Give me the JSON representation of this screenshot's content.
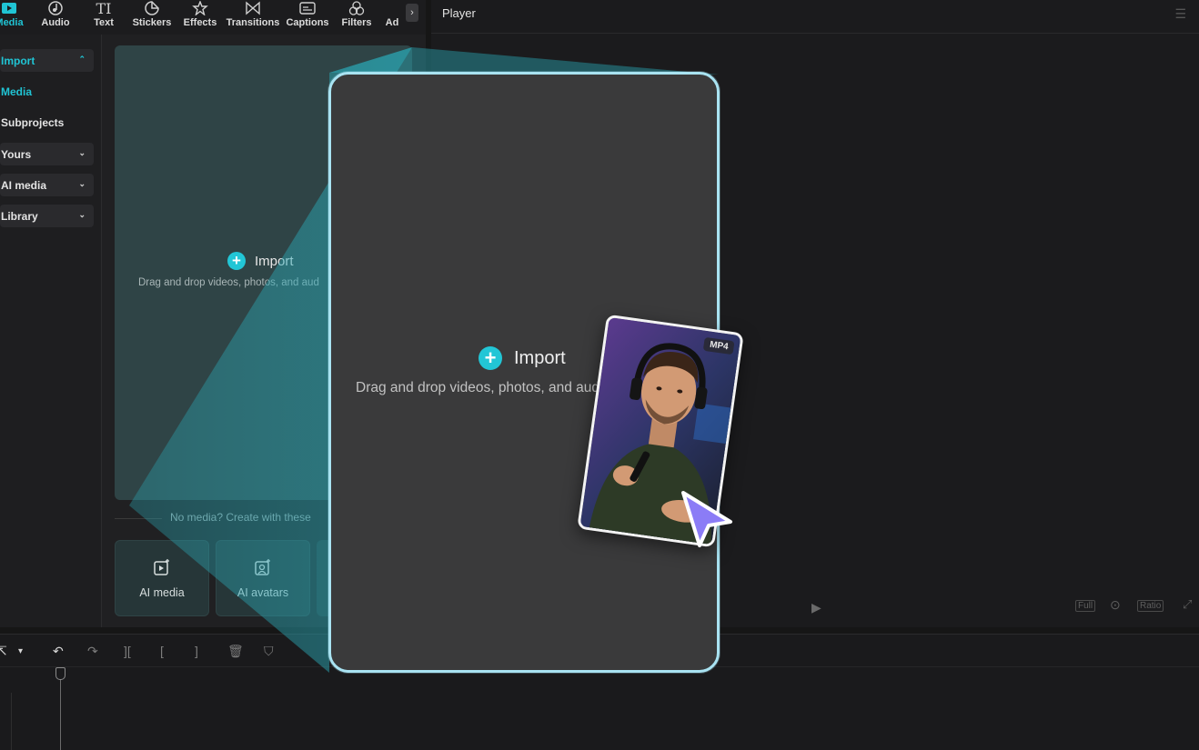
{
  "toolbar": {
    "tools": [
      {
        "label": "Media",
        "icon": "media-icon",
        "active": true
      },
      {
        "label": "Audio",
        "icon": "audio-icon"
      },
      {
        "label": "Text",
        "icon": "text-icon"
      },
      {
        "label": "Stickers",
        "icon": "stickers-icon"
      },
      {
        "label": "Effects",
        "icon": "effects-icon"
      },
      {
        "label": "Transitions",
        "icon": "transitions-icon"
      },
      {
        "label": "Captions",
        "icon": "captions-icon"
      },
      {
        "label": "Filters",
        "icon": "filters-icon"
      },
      {
        "label": "Ad",
        "icon": "adjust-icon"
      }
    ],
    "more_icon": "chevron-right-icon"
  },
  "sidenav": {
    "items": [
      {
        "label": "Import",
        "expanded": true
      },
      {
        "label": "Media"
      },
      {
        "label": "Subprojects"
      },
      {
        "label": "Yours"
      },
      {
        "label": "AI media"
      },
      {
        "label": "Library"
      }
    ]
  },
  "media_panel": {
    "import_label": "Import",
    "drag_hint": "Drag and drop videos, photos, and aud",
    "no_media_text": "No media? Create with these",
    "ai_cards": [
      {
        "label": "AI media",
        "icon": "ai-media-icon"
      },
      {
        "label": "AI avatars",
        "icon": "ai-avatars-icon"
      }
    ]
  },
  "player": {
    "title": "Player",
    "controls": [
      "Full",
      "Ratio"
    ]
  },
  "modal": {
    "import_label": "Import",
    "drag_hint": "Drag and drop videos, photos, and aud"
  },
  "thumbnail": {
    "badge": "MP4"
  },
  "colors": {
    "accent": "#22c6d6",
    "modal_border": "#a9e3f2",
    "cursor": "#8b7cf6"
  }
}
